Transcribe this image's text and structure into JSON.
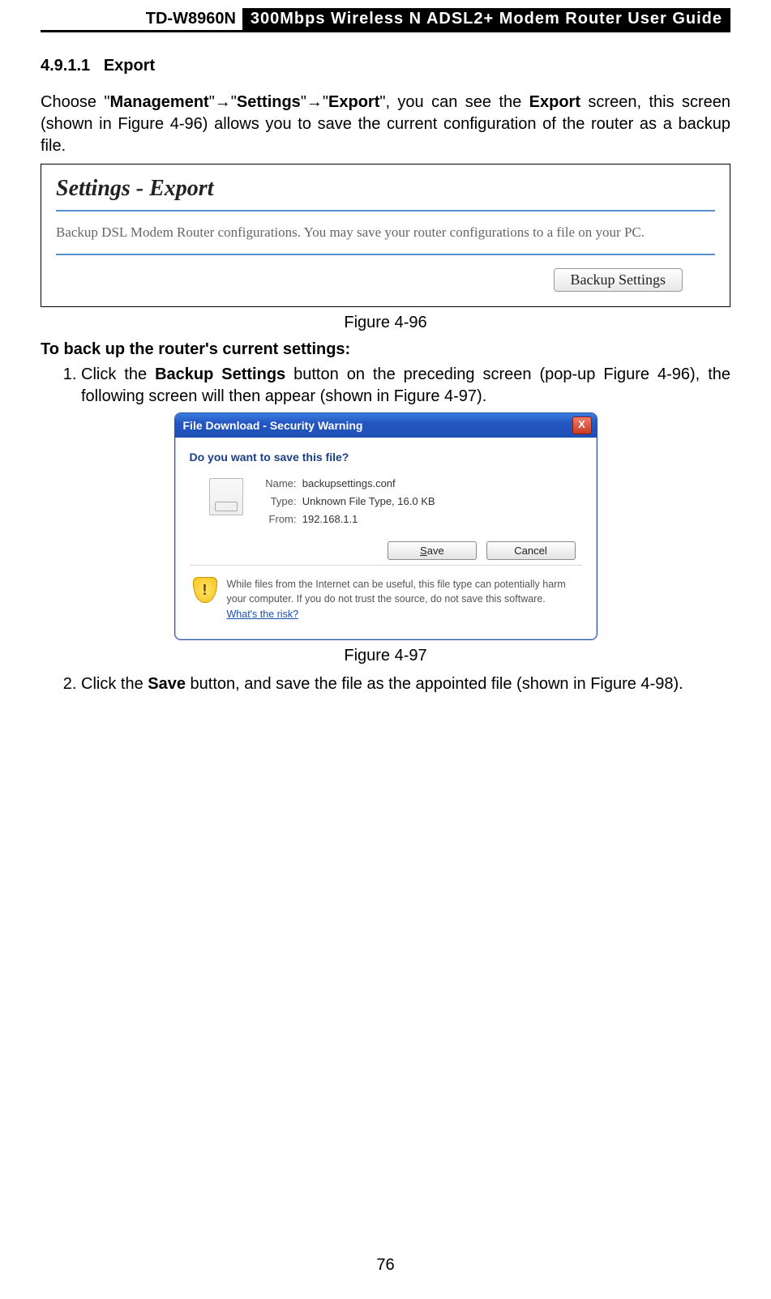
{
  "header": {
    "model": "TD-W8960N",
    "title": "300Mbps Wireless N ADSL2+ Modem Router User Guide"
  },
  "section_number": "4.9.1.1",
  "section_name": "Export",
  "intro": {
    "pre": "Choose \"",
    "m1": "Management",
    "arrow1": "\"→\"",
    "m2": "Settings",
    "arrow2": "\"→\"",
    "m3": "Export",
    "mid": "\", you can see the ",
    "m4": "Export",
    "post": " screen, this screen (shown in Figure 4-96) allows you to save the current configuration of the router as a backup file."
  },
  "fig96": {
    "panel_title": "Settings - Export",
    "desc": "Backup DSL Modem Router configurations. You may save your router configurations to a file on your PC.",
    "button": "Backup Settings",
    "caption": "Figure 4-96"
  },
  "subhead": "To back up the router's current settings:",
  "step1": {
    "pre": "Click the ",
    "bold": "Backup Settings",
    "post": " button on the preceding screen (pop-up Figure 4-96), the following screen will then appear (shown in Figure 4-97)."
  },
  "fig97": {
    "title": "File Download - Security Warning",
    "question": "Do you want to save this file?",
    "name_label": "Name:",
    "name_value": "backupsettings.conf",
    "type_label": "Type:",
    "type_value": "Unknown File Type, 16.0 KB",
    "from_label": "From:",
    "from_value": "192.168.1.1",
    "save_btn_pre": "S",
    "save_btn_rest": "ave",
    "cancel_btn": "Cancel",
    "close_x": "X",
    "warn_text": "While files from the Internet can be useful, this file type can potentially harm your computer. If you do not trust the source, do not save this software. ",
    "warn_link": "What's the risk?",
    "caption": "Figure 4-97"
  },
  "step2": {
    "pre": "Click the ",
    "bold": "Save",
    "post": " button, and save the file as the appointed file (shown in Figure 4-98)."
  },
  "page_number": "76"
}
